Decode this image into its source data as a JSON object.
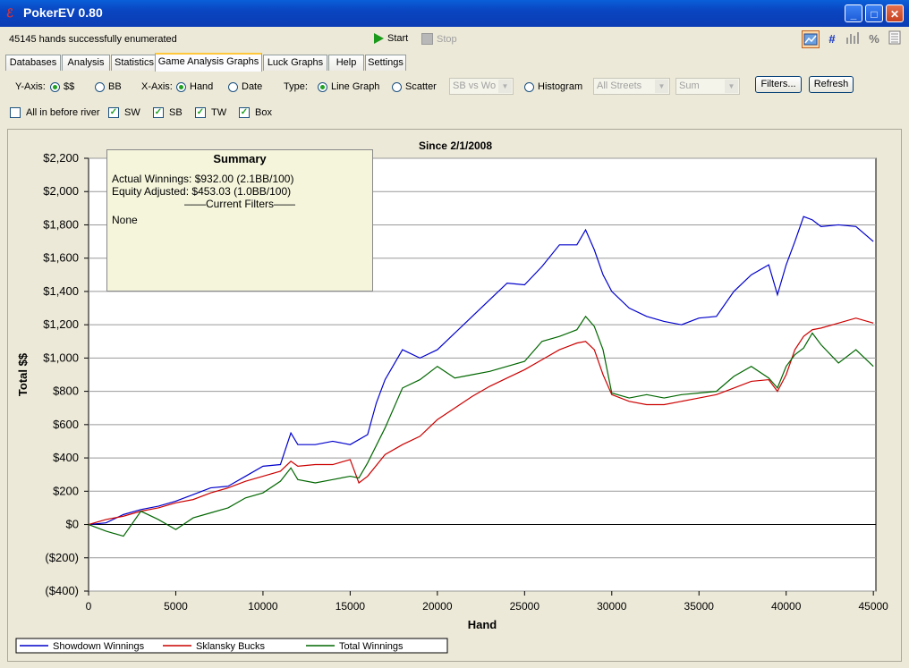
{
  "window": {
    "title": "PokerEV 0.80",
    "app_icon": "poker-ev-icon",
    "min": "_",
    "max": "□",
    "close": "✕"
  },
  "toolbar": {
    "status": "45145 hands successfully enumerated",
    "start": "Start",
    "stop": "Stop",
    "right_icons": [
      "graph-icon",
      "hash-icon",
      "bar-chart-icon",
      "percent-icon",
      "text-list-icon"
    ]
  },
  "tabs": [
    "Databases",
    "Analysis",
    "Statistics",
    "Game Analysis Graphs",
    "Luck Graphs",
    "Help",
    "Settings"
  ],
  "active_tab": "Game Analysis Graphs",
  "options": {
    "yaxis_label": "Y-Axis:",
    "y_dollars": "$$",
    "y_bb": "BB",
    "xaxis_label": "X-Axis:",
    "x_hand": "Hand",
    "x_date": "Date",
    "type_label": "Type:",
    "line_graph": "Line Graph",
    "scatter": "Scatter",
    "scatter_combo": "SB vs Wo",
    "histogram": "Histogram",
    "streets_combo": "All Streets",
    "sum_combo": "Sum",
    "filters": "Filters...",
    "refresh": "Refresh",
    "all_in": "All in before river",
    "sw": "SW",
    "sb": "SB",
    "tw": "TW",
    "box": "Box"
  },
  "summary": {
    "title": "Summary",
    "actual": "Actual Winnings: $932.00 (2.1BB/100)",
    "equity": "Equity Adjusted: $453.03 (1.0BB/100)",
    "filters_header": "——Current Filters——",
    "filters_value": "None"
  },
  "chart_data": {
    "type": "line",
    "title": "Since 2/1/2008",
    "xlabel": "Hand",
    "ylabel": "Total $$",
    "xlim": [
      0,
      45145
    ],
    "ylim": [
      -400,
      2200
    ],
    "xticks": [
      0,
      5000,
      10000,
      15000,
      20000,
      25000,
      30000,
      35000,
      40000,
      45000
    ],
    "xtick_labels": [
      "0",
      "5000",
      "10000",
      "15000",
      "20000",
      "25000",
      "30000",
      "35000",
      "40000",
      "45000"
    ],
    "yticks": [
      -400,
      -200,
      0,
      200,
      400,
      600,
      800,
      1000,
      1200,
      1400,
      1600,
      1800,
      2000,
      2200
    ],
    "ytick_labels": [
      "($400)",
      "($200)",
      "$0",
      "$200",
      "$400",
      "$600",
      "$800",
      "$1,000",
      "$1,200",
      "$1,400",
      "$1,600",
      "$1,800",
      "$2,000",
      "$2,200"
    ],
    "grid": true,
    "legend": "bottom-left",
    "series": [
      {
        "name": "Showdown Winnings",
        "color": "#0000cc",
        "x": [
          0,
          1000,
          2000,
          3000,
          4000,
          5000,
          6000,
          7000,
          8000,
          9000,
          10000,
          11000,
          11600,
          12000,
          13000,
          14000,
          15000,
          16000,
          16500,
          17000,
          18000,
          19000,
          20000,
          21000,
          22000,
          23000,
          24000,
          25000,
          26000,
          27000,
          28000,
          28500,
          29000,
          29500,
          30000,
          31000,
          32000,
          33000,
          34000,
          35000,
          36000,
          37000,
          38000,
          39000,
          39500,
          40000,
          40500,
          41000,
          41500,
          42000,
          43000,
          44000,
          45000
        ],
        "y": [
          0,
          10,
          60,
          90,
          110,
          140,
          180,
          220,
          230,
          290,
          350,
          360,
          550,
          480,
          480,
          500,
          480,
          540,
          730,
          870,
          1050,
          1000,
          1050,
          1150,
          1250,
          1350,
          1450,
          1440,
          1550,
          1680,
          1680,
          1770,
          1650,
          1500,
          1400,
          1300,
          1250,
          1220,
          1200,
          1240,
          1250,
          1400,
          1500,
          1560,
          1380,
          1560,
          1700,
          1850,
          1830,
          1790,
          1800,
          1790,
          1700
        ]
      },
      {
        "name": "Sklansky Bucks",
        "color": "#cc0000",
        "x": [
          0,
          1000,
          2000,
          3000,
          4000,
          5000,
          6000,
          7000,
          8000,
          9000,
          10000,
          11000,
          11600,
          12000,
          13000,
          14000,
          15000,
          15500,
          16000,
          17000,
          18000,
          19000,
          20000,
          21000,
          22000,
          23000,
          24000,
          25000,
          26000,
          27000,
          28000,
          28500,
          29000,
          29500,
          30000,
          31000,
          32000,
          33000,
          34000,
          35000,
          36000,
          37000,
          38000,
          39000,
          39500,
          40000,
          40500,
          41000,
          41500,
          42000,
          43000,
          44000,
          45000
        ],
        "y": [
          0,
          30,
          50,
          80,
          100,
          130,
          150,
          190,
          220,
          260,
          290,
          320,
          380,
          350,
          360,
          360,
          390,
          250,
          290,
          420,
          480,
          530,
          630,
          700,
          770,
          830,
          880,
          930,
          990,
          1050,
          1090,
          1100,
          1050,
          900,
          780,
          740,
          720,
          720,
          740,
          760,
          780,
          820,
          860,
          870,
          800,
          900,
          1050,
          1130,
          1170,
          1180,
          1210,
          1240,
          1210
        ]
      },
      {
        "name": "Total Winnings",
        "color": "#006600",
        "x": [
          0,
          1000,
          2000,
          3000,
          4000,
          5000,
          6000,
          7000,
          8000,
          9000,
          10000,
          11000,
          11600,
          12000,
          13000,
          14000,
          15000,
          15500,
          16000,
          17000,
          18000,
          19000,
          20000,
          21000,
          22000,
          23000,
          24000,
          25000,
          26000,
          27000,
          28000,
          28500,
          29000,
          29500,
          30000,
          31000,
          32000,
          33000,
          34000,
          35000,
          36000,
          37000,
          38000,
          39000,
          39500,
          40000,
          40500,
          41000,
          41500,
          42000,
          43000,
          44000,
          45000
        ],
        "y": [
          0,
          -40,
          -70,
          80,
          30,
          -30,
          40,
          70,
          100,
          160,
          190,
          260,
          340,
          270,
          250,
          270,
          290,
          280,
          370,
          580,
          820,
          870,
          950,
          880,
          900,
          920,
          950,
          980,
          1100,
          1130,
          1170,
          1250,
          1190,
          1050,
          790,
          760,
          780,
          760,
          780,
          790,
          800,
          890,
          950,
          880,
          820,
          950,
          1020,
          1060,
          1150,
          1080,
          970,
          1050,
          950
        ]
      }
    ]
  }
}
